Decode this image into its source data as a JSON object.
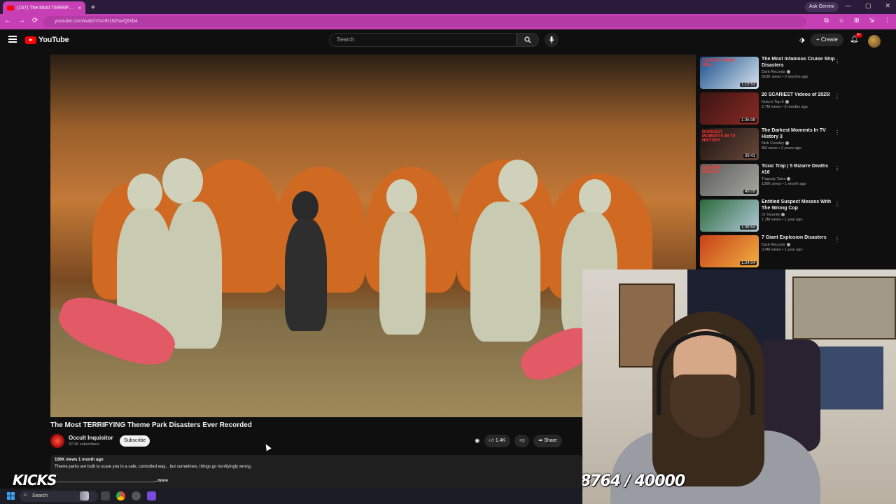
{
  "browser": {
    "tab_title": "(157) The Most TERRIFYING...",
    "tab_close": "×",
    "new_tab": "+",
    "ask_gemini": "Ask Gemini",
    "url": "youtube.com/watch?v=9r16ZswQtXb4",
    "nav": [
      "←",
      "→",
      "⟳"
    ],
    "window_controls": [
      "—",
      "▢",
      "✕"
    ],
    "ext_icons": [
      "⧉",
      "☆",
      "⊞",
      "⇲",
      "⋮"
    ]
  },
  "masthead": {
    "logo_text": "YouTube",
    "search_placeholder": "Search",
    "create_label": "+ Create",
    "notif_badge": "9+"
  },
  "video": {
    "title": "The Most TERRIFYING Theme Park Disasters Ever Recorded",
    "channel_name": "Occult Inquisitor",
    "channel_subs": "32.2K subscribers",
    "subscribe_label": "Subscribe",
    "likes": "1.4K",
    "share_label": "Share",
    "views_line": "106K views  1 month ago",
    "description": "Theme parks are built to scare you in a safe, controlled way... but sometimes, things go horrifyingly wrong.",
    "more_label": "...more"
  },
  "recommendations": [
    {
      "title": "The Most Infamous Cruise Ship Disasters",
      "channel": "Dark Records",
      "meta": "653K views • 2 months ago",
      "duration": "1:15:53",
      "thumb_colors": [
        "#1a4f8a",
        "#d9e4ef"
      ],
      "thumb_text": "CRUISES FROM HELL"
    },
    {
      "title": "20 SCARIEST Videos of 2025!",
      "channel": "Nuke's Top 5",
      "meta": "2.7M views • 3 months ago",
      "duration": "1:35:08",
      "thumb_colors": [
        "#3a1414",
        "#8a2a22"
      ],
      "thumb_text": ""
    },
    {
      "title": "The Darkest Moments In TV History 3",
      "channel": "Nick Crowley",
      "meta": "8M views • 2 years ago",
      "duration": "38:41",
      "thumb_colors": [
        "#1a1010",
        "#6a4a3a"
      ],
      "thumb_text": "DARKEST MOMENTS IN TV HISTORY"
    },
    {
      "title": "Toxic Trap | 5 Bizarre Deaths #16",
      "channel": "Tragedy Tales",
      "meta": "136K views • 1 month ago",
      "duration": "49:09",
      "thumb_colors": [
        "#5a5a5a",
        "#a8a8a0"
      ],
      "thumb_text": "BIZARRE DEATHS"
    },
    {
      "title": "Entitled Suspect Messes With The Wrong Cop",
      "channel": "Dr Insanity",
      "meta": "1.3M views • 1 year ago",
      "duration": "1:39:53",
      "thumb_colors": [
        "#2a6a3a",
        "#b0c8d8"
      ],
      "thumb_text": ""
    },
    {
      "title": "7 Giant Explosion Disasters",
      "channel": "Dark Records",
      "meta": "3.4M views • 1 year ago",
      "duration": "1:24:04",
      "thumb_colors": [
        "#c8401a",
        "#f0b040"
      ],
      "thumb_text": ""
    }
  ],
  "overlay": {
    "kicks_logo": "KICKS",
    "counter": "8764 / 40000"
  },
  "taskbar": {
    "search_label": "Search"
  }
}
